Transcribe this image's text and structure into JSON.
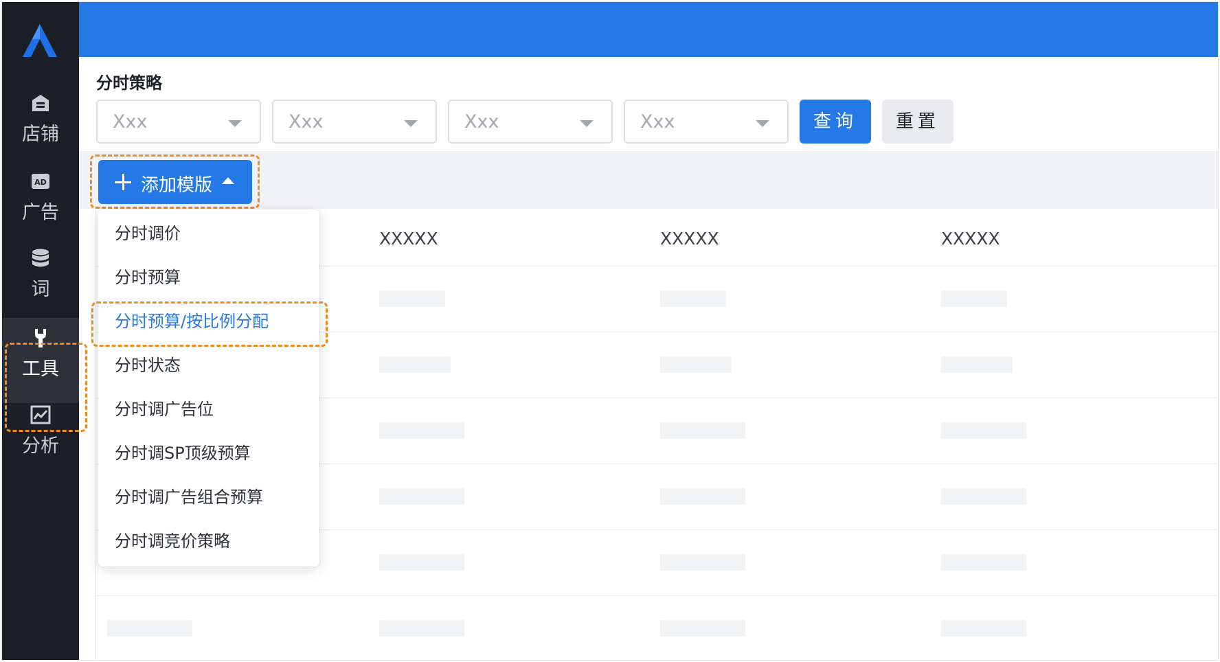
{
  "colors": {
    "sidebar_bg": "#1c1f25",
    "accent": "#2479e6",
    "highlight_dash": "#f08a24"
  },
  "sidebar": {
    "logo": "a-logo-icon",
    "items": [
      {
        "icon": "shop-icon",
        "label": "店铺"
      },
      {
        "icon": "ad-icon",
        "label": "广告"
      },
      {
        "icon": "database-icon",
        "label": "词"
      },
      {
        "icon": "wrench-icon",
        "label": "工具",
        "active": true
      },
      {
        "icon": "chart-icon",
        "label": "分析"
      }
    ]
  },
  "page": {
    "title": "分时策略"
  },
  "filters": {
    "selects": [
      {
        "value": "Xxx"
      },
      {
        "value": "Xxx"
      },
      {
        "value": "Xxx"
      },
      {
        "value": "Xxx"
      }
    ],
    "query_label": "查询",
    "reset_label": "重置"
  },
  "toolbar": {
    "add_template_label": "添加模版"
  },
  "table": {
    "headers": [
      "XXXXX",
      "XXXXX",
      "XXXXX"
    ]
  },
  "menu": {
    "items": [
      {
        "label": "分时调价"
      },
      {
        "label": "分时预算"
      },
      {
        "label": "分时预算/按比例分配",
        "selected": true
      },
      {
        "label": "分时状态"
      },
      {
        "label": "分时调广告位"
      },
      {
        "label": "分时调SP顶级预算"
      },
      {
        "label": "分时调广告组合预算"
      },
      {
        "label": "分时调竞价策略"
      }
    ]
  }
}
